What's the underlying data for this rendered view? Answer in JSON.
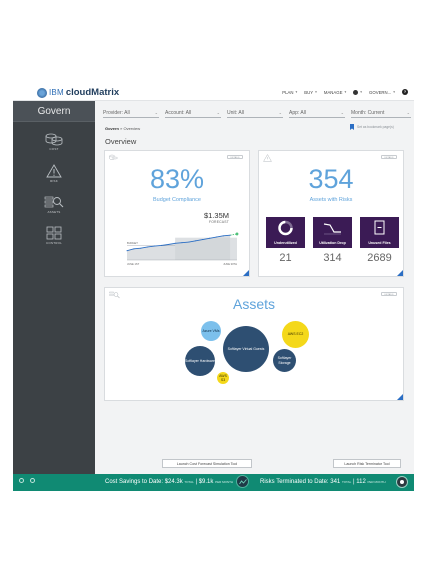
{
  "header": {
    "brand_ibm": "IBM",
    "brand_product": "cloudMatrix",
    "nav": [
      {
        "label": "PLAN"
      },
      {
        "label": "BUY"
      },
      {
        "label": "MANAGE"
      },
      {
        "label": "GOVERN..."
      }
    ]
  },
  "sidebar": {
    "title": "Govern",
    "items": [
      {
        "label": "COST",
        "icon": "coins-icon"
      },
      {
        "label": "RISK",
        "icon": "warning-icon"
      },
      {
        "label": "ASSETS",
        "icon": "search-assets-icon"
      },
      {
        "label": "CONTROL",
        "icon": "grid-icon"
      }
    ]
  },
  "filters": [
    {
      "label": "Provider: All"
    },
    {
      "label": "Account: All"
    },
    {
      "label": "Unit: All"
    },
    {
      "label": "App: All"
    },
    {
      "label": "Month: Current"
    }
  ],
  "breadcrumb": {
    "root": "Govern",
    "sep": " » ",
    "current": "Overview"
  },
  "bookmark_text": "Set as bookmark page(s)",
  "page_title": "Overview",
  "budget_card": {
    "pill": "DETAILS",
    "percent": "83%",
    "label": "Budget Compliance",
    "amount": "$1.35M",
    "amount_sub": "FORECAST",
    "budget_tag": "BUDGET",
    "x_start": "JUNE 1ST",
    "x_end": "JUNE 30TH",
    "chart_data": {
      "type": "line",
      "x": [
        1,
        2,
        3,
        4,
        5,
        6,
        7,
        8,
        9,
        10,
        11,
        12,
        13,
        14,
        15,
        16
      ],
      "actual": [
        0.3,
        0.36,
        0.38,
        0.42,
        0.45,
        0.47,
        0.5,
        0.54,
        0.56,
        0.58,
        0.62,
        0.66,
        0.7,
        0.74,
        0.78,
        0.8
      ],
      "forecast_end": 0.84,
      "budget": 0.72
    }
  },
  "risks_card": {
    "pill": "DETAILS",
    "count": "354",
    "label": "Assets with Risks",
    "tiles": [
      {
        "label": "Underutilized",
        "value": "21",
        "icon": "donut-icon"
      },
      {
        "label": "Utilization Drop",
        "value": "314",
        "icon": "drop-chart-icon"
      },
      {
        "label": "Unused Files",
        "value": "2689",
        "icon": "file-icon"
      }
    ]
  },
  "assets_card": {
    "pill": "DETAILS",
    "title": "Assets",
    "bubbles": [
      {
        "label": "Azure VMs",
        "color": "#7cc0ec",
        "text_color": "#0b2a44"
      },
      {
        "label": "Softlayer Virtual Guests",
        "color": "#2e4f72",
        "text_color": "#ffffff"
      },
      {
        "label": "AWS EC2",
        "color": "#f4d81a",
        "text_color": "#3a3000"
      },
      {
        "label": "Softlayer Hardware",
        "color": "#2e4f72",
        "text_color": "#ffffff"
      },
      {
        "label": "Softlayer Storage",
        "color": "#2e4f72",
        "text_color": "#ffffff"
      },
      {
        "label": "AWS S3",
        "color": "#f4d81a",
        "text_color": "#3a3000"
      }
    ]
  },
  "actions": {
    "cost_tool": "Launch Cost Forecast Simulation Tool",
    "risk_tool": "Launch Risk Terminator Tool"
  },
  "footer": {
    "savings_label": "Cost Savings to Date: $24.3k",
    "savings_total": "TOTAL",
    "savings_rate": "$9.1k",
    "savings_rate_unit": "PER MONTH",
    "risks_label": "Risks Terminated to Date: 341",
    "risks_total": "TOTAL",
    "risks_rate": "112",
    "risks_rate_unit": "PER MONTH"
  },
  "colors": {
    "accent": "#5fa3db",
    "tile": "#3b1b55",
    "footer": "#108a73",
    "sidebar": "#3c4145"
  }
}
